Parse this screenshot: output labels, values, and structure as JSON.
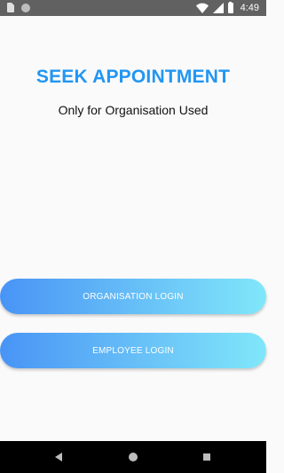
{
  "status_bar": {
    "time": "4:49",
    "icons": [
      "sim-card-icon",
      "circle-icon",
      "wifi-icon",
      "signal-icon",
      "battery-icon"
    ]
  },
  "main": {
    "title": "SEEK APPOINTMENT",
    "subtitle": "Only for Organisation Used",
    "buttons": {
      "organisation_login": "ORGANISATION LOGIN",
      "employee_login": "EMPLOYEE LOGIN"
    }
  },
  "nav_bar": {
    "icons": [
      "back-icon",
      "home-icon",
      "recents-icon"
    ]
  },
  "colors": {
    "title": "#2196f3",
    "button_gradient_start": "#4894f6",
    "button_gradient_end": "#80e7fa",
    "status_bar": "#616161",
    "nav_bar": "#000000",
    "background": "#fafafa"
  }
}
